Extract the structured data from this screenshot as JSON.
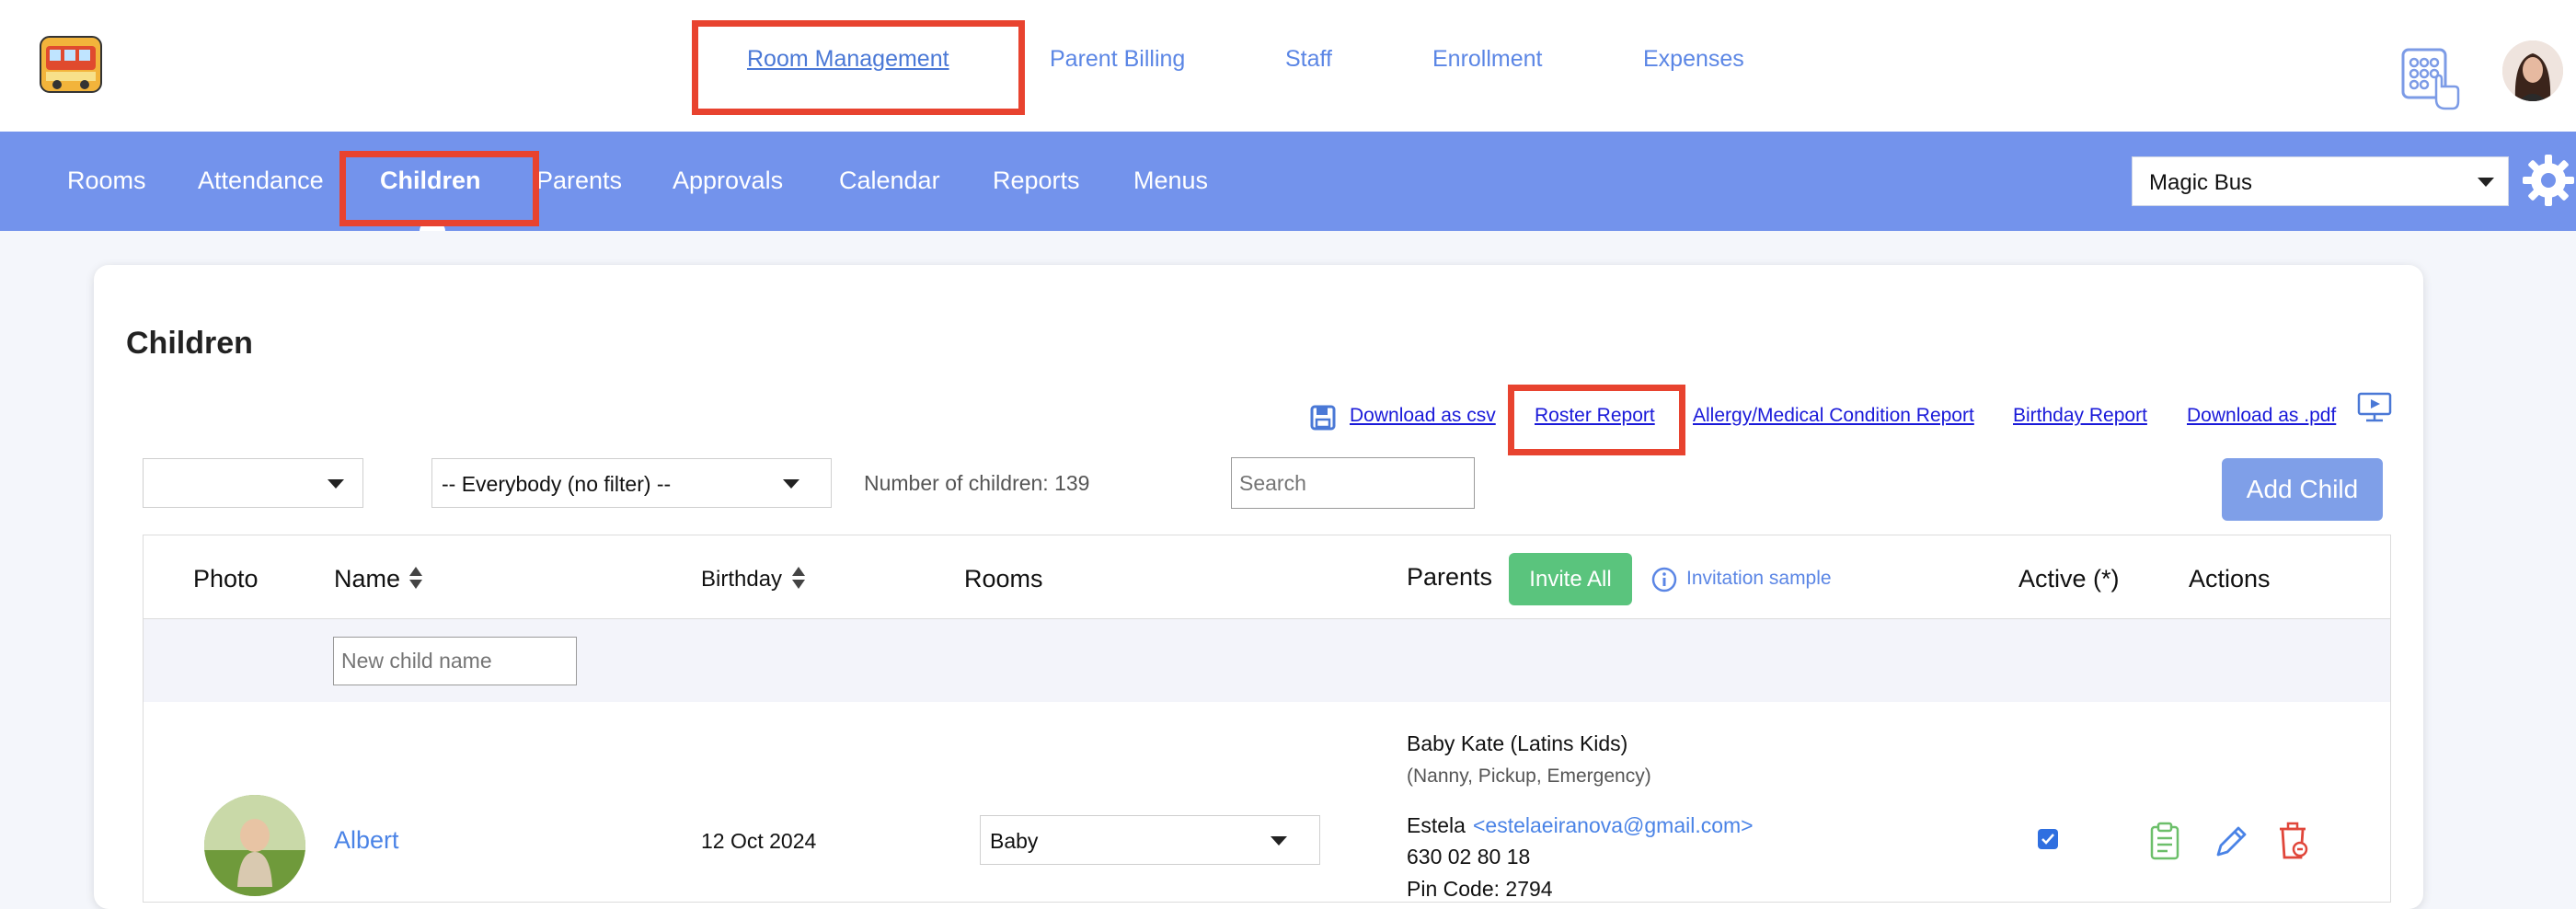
{
  "top_nav": {
    "items": [
      "Room Management",
      "Parent Billing",
      "Staff",
      "Enrollment",
      "Expenses"
    ]
  },
  "sub_nav": {
    "items": [
      "Rooms",
      "Attendance",
      "Children",
      "Parents",
      "Approvals",
      "Calendar",
      "Reports",
      "Menus"
    ],
    "active": "Children",
    "school": "Magic Bus"
  },
  "page": {
    "title": "Children",
    "links": {
      "download_csv": "Download as csv",
      "roster_report": "Roster Report",
      "allergy_report": "Allergy/Medical Condition Report",
      "birthday_report": "Birthday Report",
      "download_pdf": "Download as .pdf"
    },
    "filter_everybody": "-- Everybody (no filter) --",
    "count_text": "Number of children: 139",
    "search_placeholder": "Search",
    "add_child_label": "Add Child"
  },
  "table": {
    "headers": {
      "photo": "Photo",
      "name": "Name",
      "birthday": "Birthday",
      "rooms": "Rooms",
      "parents": "Parents",
      "active": "Active (*)",
      "actions": "Actions"
    },
    "invite_all_label": "Invite All",
    "invitation_sample": "Invitation sample",
    "new_child_placeholder": "New child name",
    "rows": [
      {
        "name": "Albert",
        "birthday": "12 Oct 2024",
        "room": "Baby",
        "parent1_name": "Baby Kate (Latins Kids)",
        "parent1_roles": "(Nanny, Pickup, Emergency)",
        "parent2_name": "Estela",
        "parent2_email": "<estelaeiranova@gmail.com>",
        "parent2_phone": "630 02 80 18",
        "parent2_pin": "Pin Code: 2794",
        "active": true
      }
    ]
  },
  "colors": {
    "accent": "#7393ec",
    "link": "#5b86e5",
    "highlight": "#e8432f",
    "invite_green": "#5ac47d",
    "add_button": "#7f9fe8"
  },
  "icons": [
    "logo-bus-icon",
    "keypad-touch-icon",
    "gear-icon",
    "save-icon",
    "presentation-icon",
    "sort-icon",
    "info-icon",
    "clipboard-icon",
    "pencil-icon",
    "trash-icon",
    "chevron-down-icon"
  ]
}
